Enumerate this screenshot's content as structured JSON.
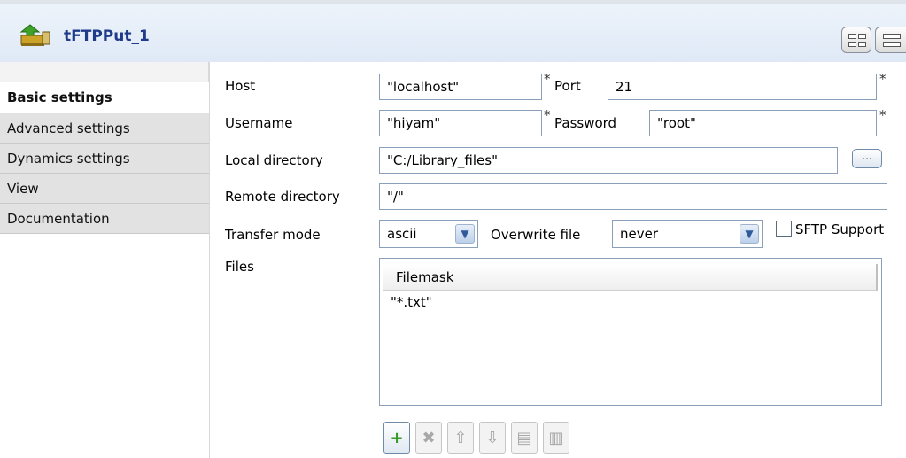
{
  "header": {
    "title": "tFTPPut_1"
  },
  "tabs": [
    {
      "label": "Basic settings",
      "active": true
    },
    {
      "label": "Advanced settings",
      "active": false
    },
    {
      "label": "Dynamics settings",
      "active": false
    },
    {
      "label": "View",
      "active": false
    },
    {
      "label": "Documentation",
      "active": false
    }
  ],
  "form": {
    "host": {
      "label": "Host",
      "value": "\"localhost\""
    },
    "port": {
      "label": "Port",
      "value": "21"
    },
    "username": {
      "label": "Username",
      "value": "\"hiyam\""
    },
    "password": {
      "label": "Password",
      "value": "\"root\""
    },
    "local_directory": {
      "label": "Local directory",
      "value": "\"C:/Library_files\"",
      "browse_label": "..."
    },
    "remote_directory": {
      "label": "Remote directory",
      "value": "\"/\""
    },
    "transfer_mode": {
      "label": "Transfer mode",
      "value": "ascii"
    },
    "overwrite_file": {
      "label": "Overwrite file",
      "value": "never"
    },
    "sftp_support": {
      "label": "SFTP Support",
      "checked": false
    },
    "required_marker": "*",
    "files": {
      "label": "Files",
      "columns": [
        "Filemask"
      ],
      "rows": [
        [
          "\"*.txt\""
        ]
      ]
    }
  },
  "toolbar": {
    "buttons": [
      {
        "name": "add",
        "icon": "plus-icon",
        "symbol": "+",
        "enabled": true
      },
      {
        "name": "remove",
        "icon": "delete-icon",
        "symbol": "✖",
        "enabled": false
      },
      {
        "name": "move-up",
        "icon": "arrow-up-icon",
        "symbol": "⇧",
        "enabled": false
      },
      {
        "name": "move-down",
        "icon": "arrow-down-icon",
        "symbol": "⇩",
        "enabled": false
      },
      {
        "name": "copy",
        "icon": "copy-icon",
        "symbol": "▤",
        "enabled": false
      },
      {
        "name": "paste",
        "icon": "paste-icon",
        "symbol": "▥",
        "enabled": false
      }
    ]
  },
  "colors": {
    "title": "#1f3a8a",
    "add_button": "#3a9a2a",
    "field_border": "#8aa0b8"
  }
}
